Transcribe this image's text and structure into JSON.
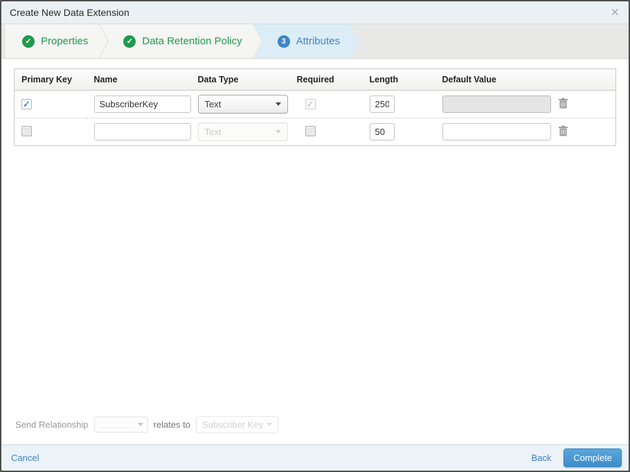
{
  "modal": {
    "title": "Create New Data Extension",
    "close_glyph": "×"
  },
  "steps": [
    {
      "label": "Properties",
      "state": "complete",
      "icon": "✓"
    },
    {
      "label": "Data Retention Policy",
      "state": "complete",
      "icon": "✓"
    },
    {
      "label": "Attributes",
      "state": "active",
      "number": "3"
    }
  ],
  "attributes_table": {
    "headers": {
      "primary_key": "Primary Key",
      "name": "Name",
      "data_type": "Data Type",
      "required": "Required",
      "length": "Length",
      "default_value": "Default Value"
    },
    "rows": [
      {
        "primary_key_checked": true,
        "name": "SubscriberKey",
        "data_type": "Text",
        "data_type_disabled": false,
        "required_checked": true,
        "required_disabled": true,
        "length": "250",
        "default_value": "",
        "default_disabled": true
      },
      {
        "primary_key_checked": false,
        "name": "",
        "data_type": "Text",
        "data_type_disabled": true,
        "required_checked": false,
        "required_disabled": false,
        "length": "50",
        "default_value": "",
        "default_disabled": false
      }
    ]
  },
  "send_relationship": {
    "label": "Send Relationship",
    "relates_to": "relates to",
    "target_value": "Subscriber Key"
  },
  "footer": {
    "cancel": "Cancel",
    "back": "Back",
    "complete": "Complete"
  },
  "colors": {
    "accent_blue": "#3e86c6",
    "success_green": "#21994e",
    "active_step_bg": "#dcedf7",
    "titlebar_bg": "#e9f1f4",
    "footer_bg": "#ebf3f8",
    "button_blue_top": "#58a7dd",
    "button_blue_bottom": "#3e8cc9"
  }
}
